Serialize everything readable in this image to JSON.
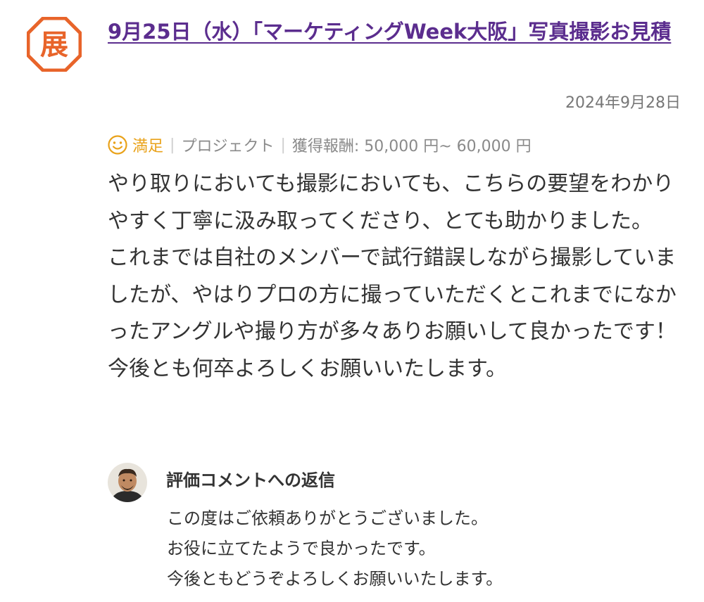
{
  "logo": {
    "char": "展",
    "icon": "exhibition-badge-icon",
    "color": "#e8642a"
  },
  "post": {
    "title": "9月25日（水）「マーケティングWeek大阪」写真撮影お見積",
    "date": "2024年9月28日"
  },
  "meta": {
    "rating_icon": "smile-icon",
    "rating": "満足",
    "type": "プロジェクト",
    "reward": "獲得報酬: 50,000 円~ 60,000 円",
    "rating_color": "#e9a21a"
  },
  "review": {
    "paragraphs": [
      "やり取りにおいても撮影においても、こちらの要望をわかりやすく丁寧に汲み取ってくださり、とても助かりました。",
      "これまでは自社のメンバーで試行錯誤しながら撮影していましたが、やはりプロの方に撮っていただくとこれまでになかったアングルや撮り方が多々ありお願いして良かったです！",
      "今後とも何卒よろしくお願いいたします。"
    ]
  },
  "reply": {
    "title": "評価コメントへの返信",
    "lines": [
      "この度はご依頼ありがとうございました。",
      "お役に立てたようで良かったです。",
      "今後ともどうぞよろしくお願いいたします。"
    ]
  }
}
